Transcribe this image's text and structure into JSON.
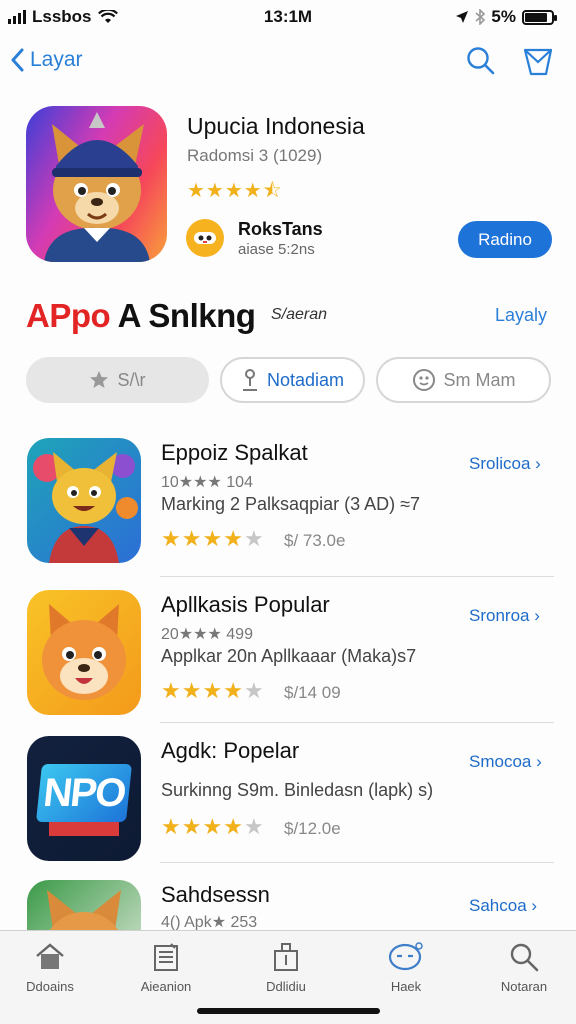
{
  "status": {
    "carrier": "Lssbos",
    "time": "13:1M",
    "battery": "5%"
  },
  "nav": {
    "back_label": "Layar"
  },
  "hero": {
    "title": "Upucia Indonesia",
    "subtitle": "Radomsi 3 (1029)",
    "rating_stars": 4.5,
    "developer": "RoksTans",
    "developer_meta": "aiase 5:2ns",
    "button_label": "Radino"
  },
  "section": {
    "title_red": "APpo",
    "title_black": "A Snlkng",
    "note": "S/aeran",
    "link": "Layaly"
  },
  "chips": [
    {
      "label": "S/\\r",
      "icon": "star-icon"
    },
    {
      "label": "Notadiam",
      "icon": "person-icon"
    },
    {
      "label": "Sm   Mam",
      "icon": "badge-icon"
    }
  ],
  "apps": [
    {
      "name": "Eppoiz Spalkat",
      "meta": "10★★★ 104",
      "desc": "Marking 2 Palksaqpiar (3 AD) ≈7",
      "stars": 4,
      "price": "$/ 73.0e",
      "action": "Srolicoa ›",
      "icon_colors": [
        "#1fa4b8",
        "#2c6ed6"
      ]
    },
    {
      "name": "Apllkasis Popular",
      "meta": "20★★★ 499",
      "desc": "Applkar 20n Apllkaaar (Maka)s7",
      "stars": 4,
      "price": "$/14 09",
      "action": "Sronroa ›",
      "icon_colors": [
        "#f9c327",
        "#f39a1b"
      ]
    },
    {
      "name": "Agdk:  Popelar",
      "meta": "",
      "desc": "Surkinng S9m. Binledasn (lapk) s)",
      "stars": 4,
      "price": "$/12.0e",
      "action": "Smocoa ›",
      "icon_text": "NPO",
      "icon_colors": [
        "#12213f",
        "#0e1a33"
      ]
    },
    {
      "name": "Sahdsessn",
      "meta": "4() Apk★ 253",
      "desc": "",
      "stars": 0,
      "price": "",
      "action": "Sahcoa ›",
      "icon_colors": [
        "#3a9a48",
        "#f0f0e8"
      ]
    }
  ],
  "tabs": [
    {
      "label": "Ddoains",
      "icon": "home-icon"
    },
    {
      "label": "Aieanion",
      "icon": "news-icon"
    },
    {
      "label": "Ddlidiu",
      "icon": "apps-icon"
    },
    {
      "label": "Haek",
      "icon": "chat-icon"
    },
    {
      "label": "Notaran",
      "icon": "search-icon"
    }
  ],
  "colors": {
    "accent": "#1e73d9",
    "link": "#2a7fd8",
    "star": "#f1b11b",
    "section_red": "#e32424"
  }
}
